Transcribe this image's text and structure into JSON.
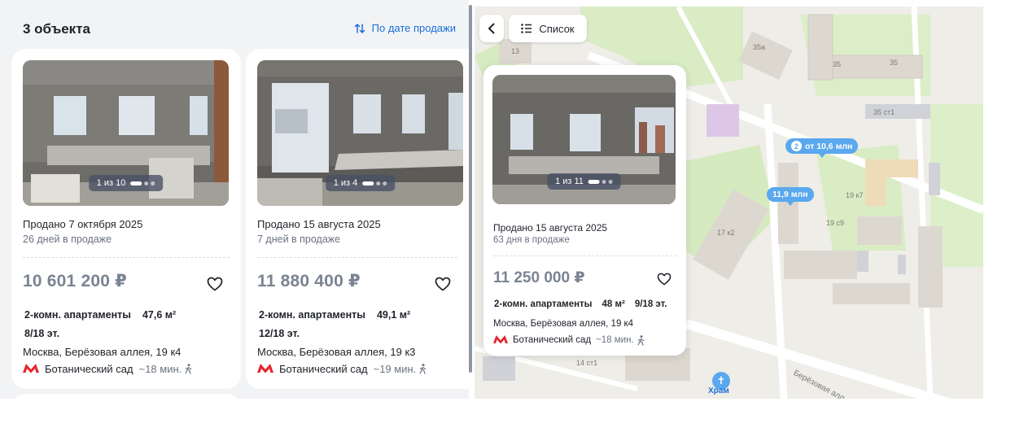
{
  "list": {
    "count_title": "3 объекта",
    "sort_label": "По дате продажи",
    "cards": [
      {
        "photo_counter": "1 из 10",
        "sold": "Продано 7 октября 2025",
        "days": "26 дней в продаже",
        "price": "10 601 200 ₽",
        "type": "2-комн. апартаменты",
        "area": "47,6 м²",
        "floor": "8/18 эт.",
        "address": "Москва, Берёзовая аллея, 19 к4",
        "metro": "Ботанический сад",
        "metro_time": "~18 мин."
      },
      {
        "photo_counter": "1 из 4",
        "sold": "Продано 15 августа 2025",
        "days": "7 дней в продаже",
        "price": "11 880 400 ₽",
        "type": "2-комн. апартаменты",
        "area": "49,1 м²",
        "floor": "12/18 эт.",
        "address": "Москва, Берёзовая аллея, 19 к3",
        "metro": "Ботанический сад",
        "metro_time": "~19 мин."
      }
    ]
  },
  "map": {
    "back_icon": "chevron-left-icon",
    "list_button": "Список",
    "popup": {
      "photo_counter": "1 из 11",
      "sold": "Продано 15 августа 2025",
      "days": "63 дня в продаже",
      "price": "11 250 000 ₽",
      "type": "2-комн. апартаменты",
      "area": "48 м²",
      "floor": "9/18 эт.",
      "address": "Москва, Берёзовая аллея, 19 к4",
      "metro": "Ботанический сад",
      "metro_time": "~18 мин."
    },
    "pins": [
      {
        "count": "2",
        "label": "от 10,6 млн"
      },
      {
        "label": "11,9 млн"
      }
    ],
    "building_labels": [
      "13",
      "35а",
      "35",
      "35",
      "35 ст1",
      "19 к7",
      "19 с9",
      "17 к2",
      "14 ст1"
    ],
    "street": "Берёзовая алл...",
    "temple": "Храм"
  },
  "colors": {
    "accent": "#1a6fd9",
    "pin": "#5aa8ee",
    "metro": "#e4262d",
    "price_sold": "#7a8492"
  }
}
